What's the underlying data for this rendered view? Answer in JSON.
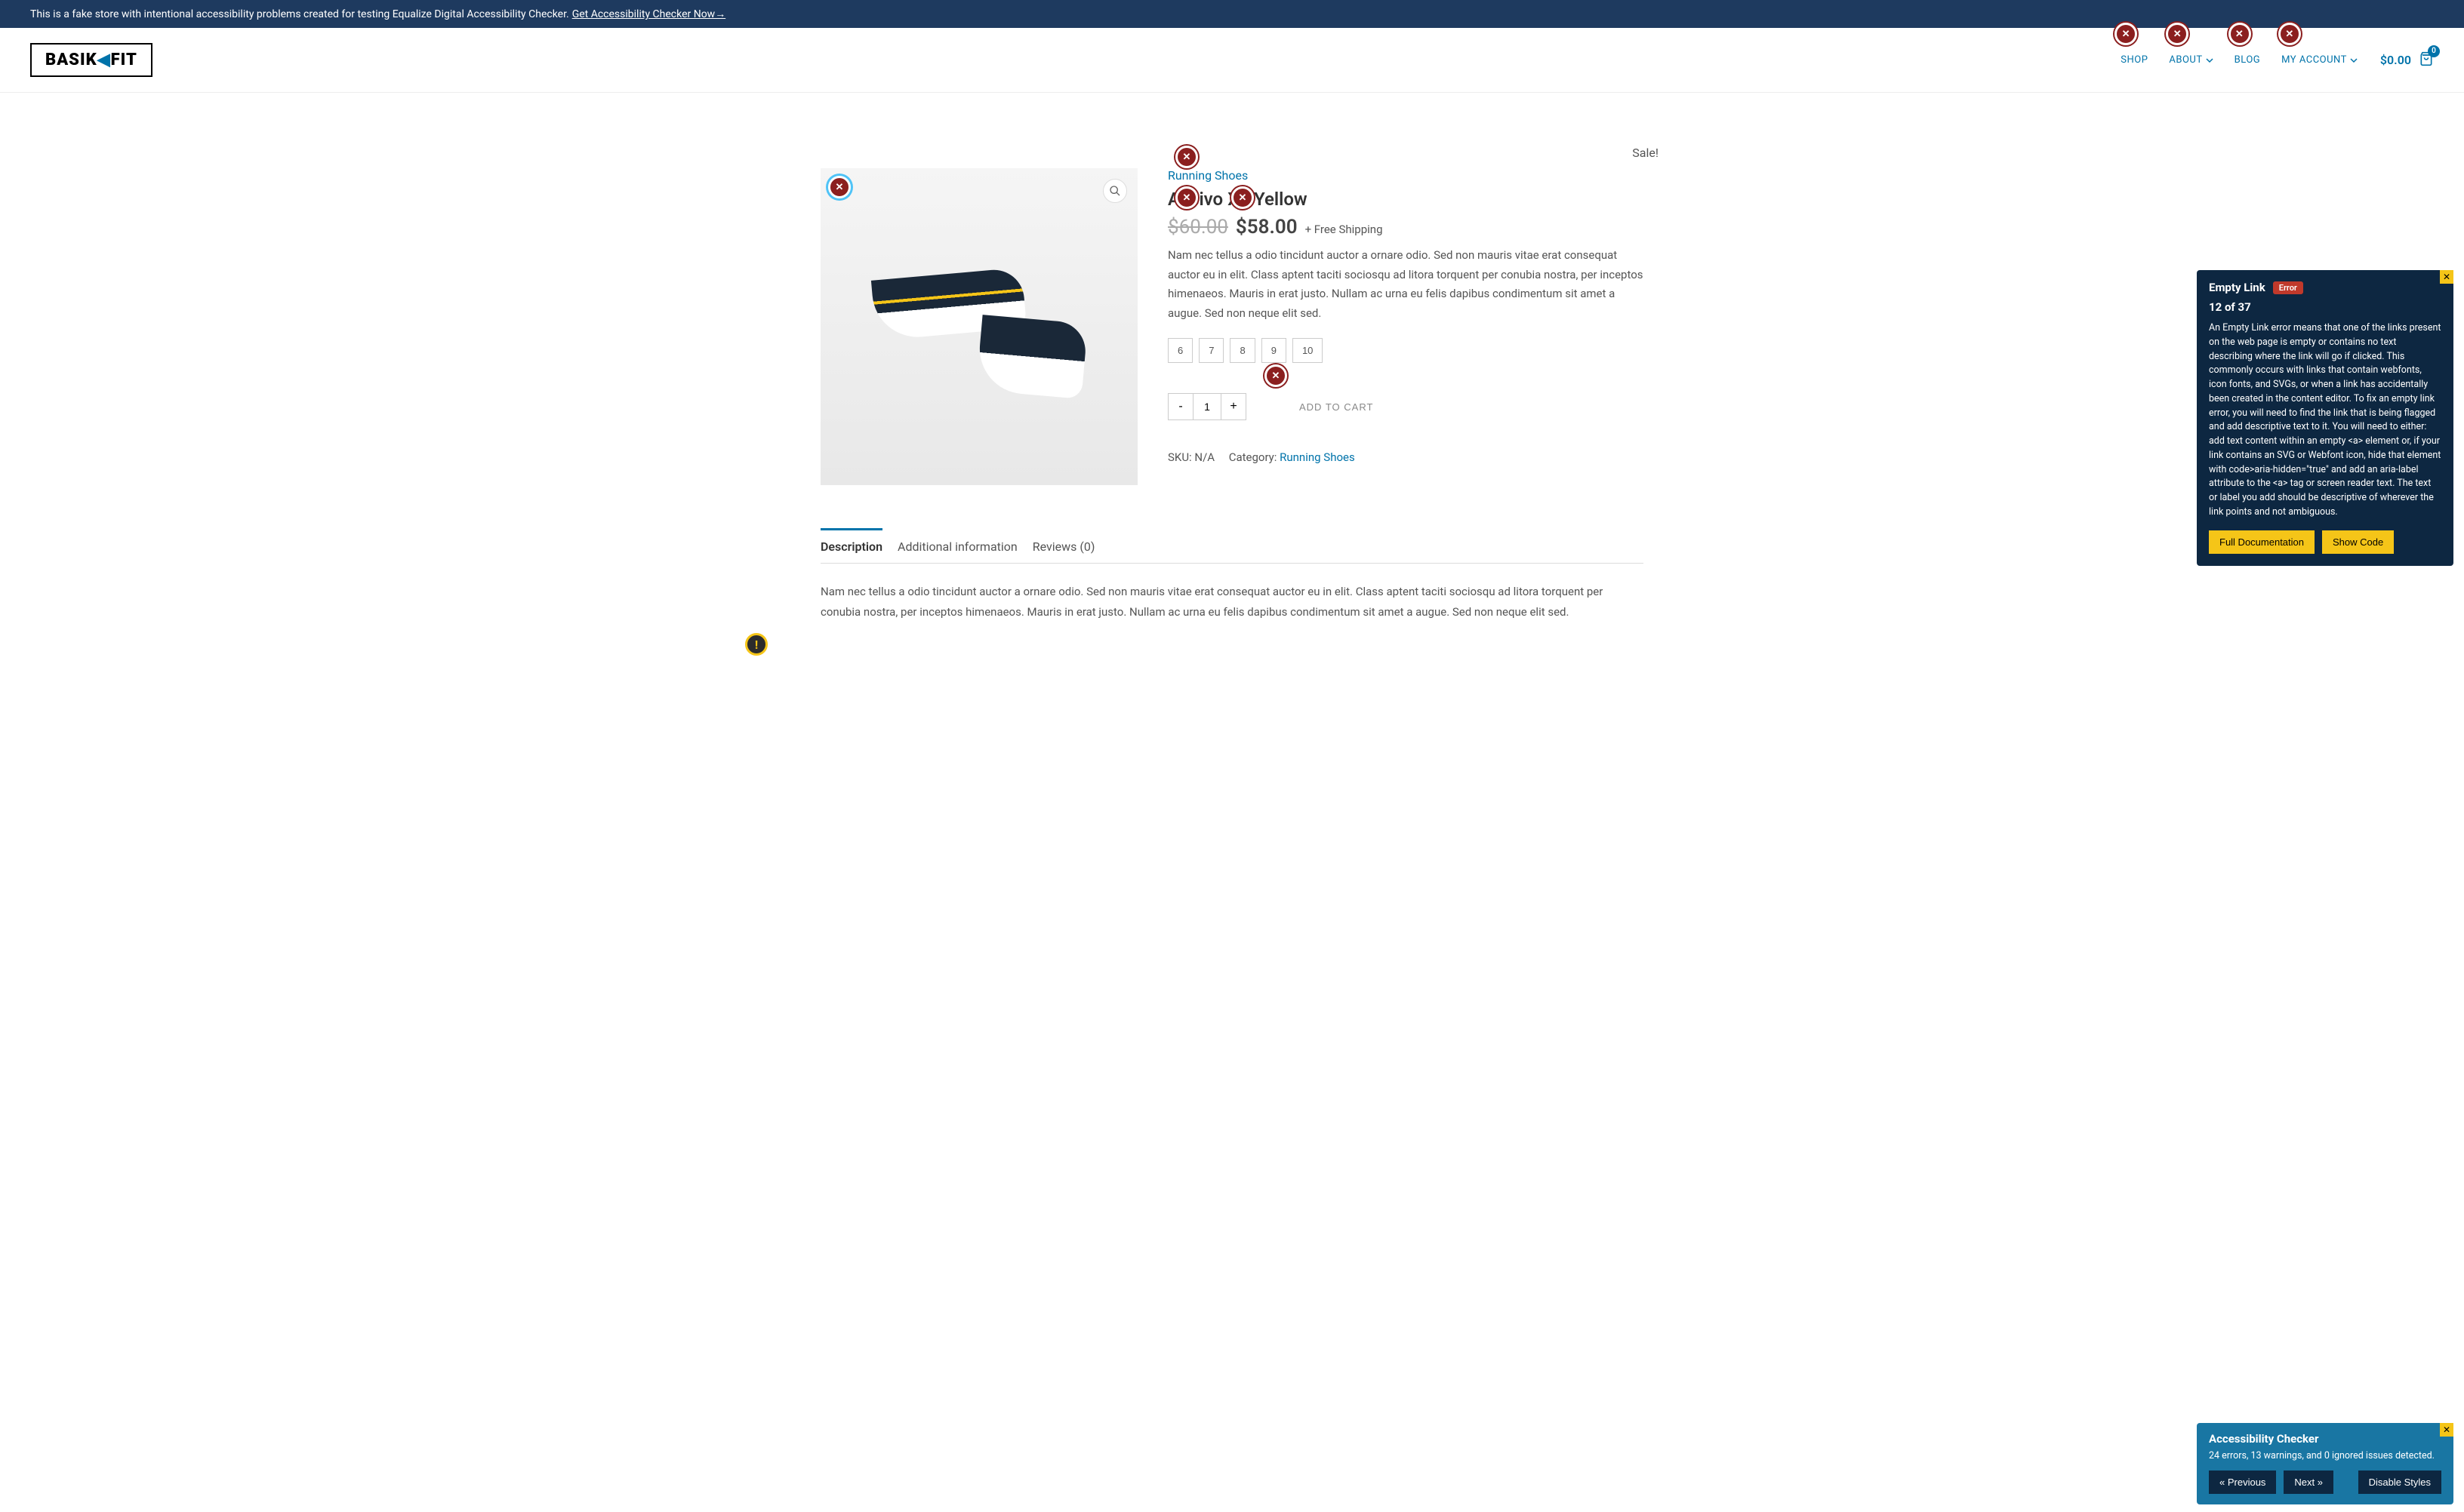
{
  "banner": {
    "text": "This is a fake store with intentional accessibility problems created for testing Equalize Digital Accessibility Checker. ",
    "link": "Get Accessibility Checker Now→"
  },
  "logo": {
    "part1": "BASIK",
    "part2": "FIT"
  },
  "nav": {
    "shop": "SHOP",
    "about": "ABOUT",
    "blog": "BLOG",
    "account": "MY ACCOUNT"
  },
  "cart": {
    "total": "$0.00",
    "count": "0"
  },
  "product": {
    "category": "Running Shoes",
    "title": "Aceivo X3 Yellow",
    "old_price": "$60.00",
    "new_price": "$58.00",
    "shipping": "+ Free Shipping",
    "description": "Nam nec tellus a odio tincidunt auctor a ornare odio. Sed non mauris vitae erat consequat auctor eu in elit. Class aptent taciti sociosqu ad litora torquent per conubia nostra, per inceptos himenaeos. Mauris in erat justo. Nullam ac urna eu felis dapibus condimentum sit amet a augue. Sed non neque elit sed.",
    "sizes": [
      "6",
      "7",
      "8",
      "9",
      "10"
    ],
    "qty": "1",
    "add_to_cart": "ADD TO CART",
    "sku_label": "SKU: ",
    "sku": "N/A",
    "cat_label": "Category: ",
    "cat_link": "Running Shoes",
    "sale": "Sale!"
  },
  "tabs": {
    "description": "Description",
    "additional": "Additional information",
    "reviews": "Reviews (0)",
    "content": "Nam nec tellus a odio tincidunt auctor a ornare odio. Sed non mauris vitae erat consequat auctor eu in elit. Class aptent taciti sociosqu ad litora torquent per conubia nostra, per inceptos himenaeos. Mauris in erat justo. Nullam ac urna eu felis dapibus condimentum sit amet a augue. Sed non neque elit sed."
  },
  "popup": {
    "title": "Empty Link",
    "badge": "Error",
    "counter": "12 of 37",
    "body": "An Empty Link error means that one of the links present on the web page is empty or contains no text describing where the link will go if clicked. This commonly occurs with links that contain webfonts, icon fonts, and SVGs, or when a link has accidentally been created in the content editor. To fix an empty link error, you will need to find the link that is being flagged and add descriptive text to it. You will need to either: add text content within an empty <a> element or, if your link contains an SVG or Webfont icon, hide that element with code>aria-hidden=\"true\" and add an aria-label attribute to the <a> tag or screen reader text. The text or label you add should be descriptive of wherever the link points and not ambiguous.",
    "doc_btn": "Full Documentation",
    "code_btn": "Show Code"
  },
  "checker": {
    "title": "Accessibility Checker",
    "summary": "24 errors, 13 warnings, and 0 ignored issues detected.",
    "prev": "« Previous",
    "next": "Next »",
    "disable": "Disable Styles"
  }
}
